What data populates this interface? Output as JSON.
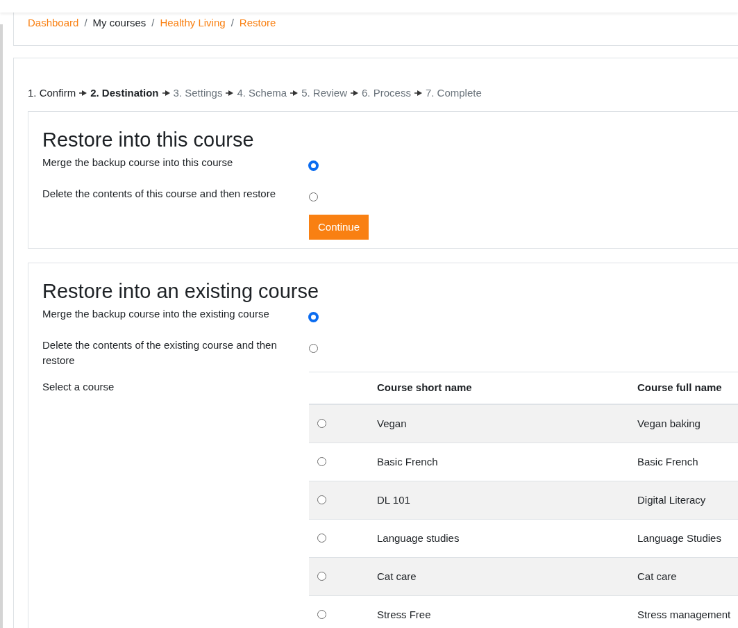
{
  "breadcrumb": [
    {
      "label": "Dashboard",
      "kind": "link"
    },
    {
      "separator": "/",
      "label": "My courses",
      "kind": "text"
    },
    {
      "separator": "/",
      "label": "Healthy Living",
      "kind": "link"
    },
    {
      "separator": "/",
      "label": "Restore",
      "kind": "link"
    }
  ],
  "steps": [
    {
      "label": "1. Confirm",
      "kind": "done"
    },
    {
      "label": "2. Destination",
      "kind": "current"
    },
    {
      "label": "3. Settings",
      "kind": "pending"
    },
    {
      "label": "4. Schema",
      "kind": "pending"
    },
    {
      "label": "5. Review",
      "kind": "pending"
    },
    {
      "label": "6. Process",
      "kind": "pending"
    },
    {
      "label": "7. Complete",
      "kind": "pending"
    }
  ],
  "this_course": {
    "title": "Restore into this course",
    "options": [
      {
        "label": "Merge the backup course into this course",
        "checked": true
      },
      {
        "label": "Delete the contents of this course and then restore",
        "checked": false
      }
    ],
    "button": "Continue"
  },
  "existing_course": {
    "title": "Restore into an existing course",
    "options": [
      {
        "label": "Merge the backup course into the existing course",
        "checked": true
      },
      {
        "label": "Delete the contents of the existing course and then restore",
        "checked": false
      }
    ],
    "select_label": "Select a course",
    "table": {
      "columns": [
        "Course short name",
        "Course full name"
      ],
      "rows": [
        {
          "cells": [
            "Vegan",
            "Vegan baking"
          ],
          "selected": false
        },
        {
          "cells": [
            "Basic French",
            "Basic French"
          ],
          "selected": false
        },
        {
          "cells": [
            "DL 101",
            "Digital Literacy"
          ],
          "selected": false
        },
        {
          "cells": [
            "Language studies",
            "Language Studies"
          ],
          "selected": false
        },
        {
          "cells": [
            "Cat care",
            "Cat care"
          ],
          "selected": false
        },
        {
          "cells": [
            "Stress Free",
            "Stress management"
          ],
          "selected": false
        }
      ]
    }
  }
}
